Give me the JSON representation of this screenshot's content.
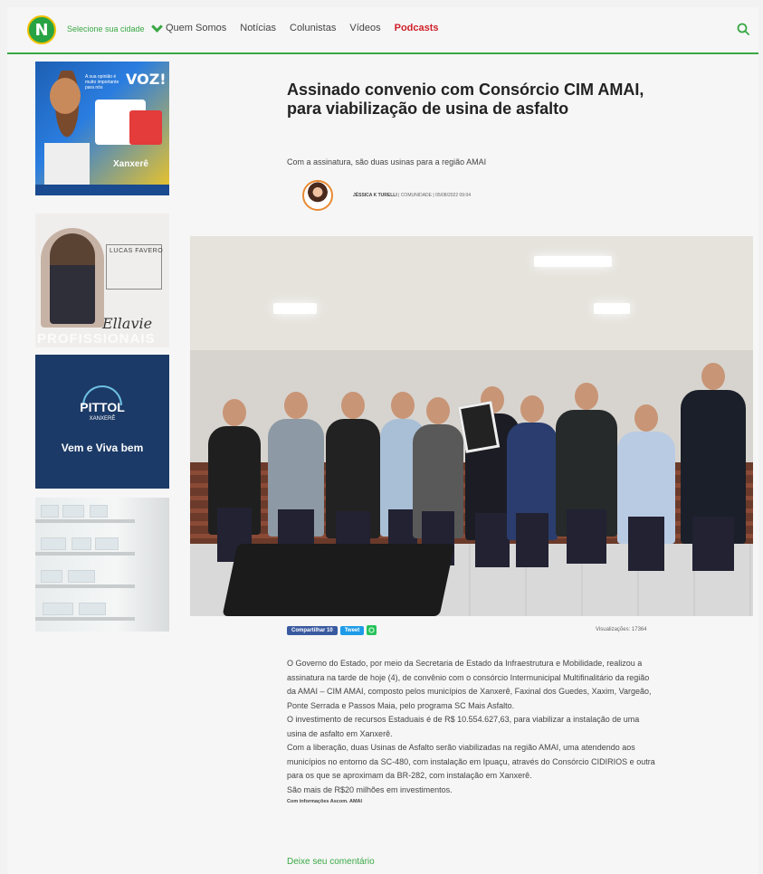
{
  "header": {
    "logo_letter": "N",
    "city_select_label": "Selecione sua cidade",
    "nav": [
      "Quem Somos",
      "Notícias",
      "Colunistas",
      "Vídeos",
      "Podcasts"
    ],
    "active_nav": "Podcasts",
    "accent_color": "#39a845",
    "active_color": "#d0202a"
  },
  "sidebar": {
    "ad1": {
      "headline": "VOZ!",
      "small": "A sua opinião é muito importante para nós",
      "city": "Xanxerê"
    },
    "ad2": {
      "name": "LUCAS FAVERO",
      "signature": "Ellavie",
      "band": "PROFISSIONAIS"
    },
    "ad3": {
      "brand": "PITTOL",
      "sub": "XANXERÊ",
      "tagline": "Vem e Viva bem"
    },
    "ad4": {
      "icon": "pharmacy-shelves"
    }
  },
  "article": {
    "title": "Assinado convenio com Consórcio CIM AMAI, para viabilização de usina de asfalto",
    "subtitle": "Com a assinatura, são duas usinas para a região AMAI",
    "author": "JÉSSICA K TURELLI",
    "category": "COMUNIDADE",
    "date": "05/08/2022 09:04",
    "share_facebook": "Compartilhar 10",
    "share_twitter": "Tweet",
    "views": "Visualizações: 17364",
    "paragraphs": [
      "O Governo do Estado, por meio da Secretaria de Estado da Infraestrutura e Mobilidade, realizou a assinatura na tarde de hoje (4), de convênio com o consórcio Intermunicipal Multifinalitário da região da AMAI – CIM AMAI, composto pelos municípios de Xanxerê, Faxinal dos Guedes, Xaxim, Vargeão, Ponte Serrada e Passos Maia, pelo programa SC Mais Asfalto.",
      "O investimento de recursos Estaduais é de R$ 10.554.627,63, para viabilizar a instalação de uma usina de asfalto em Xanxerê.",
      "Com a liberação, duas Usinas de Asfalto serão viabilizadas na região AMAI, uma atendendo aos municípios no entorno da SC-480, com instalação em Ipuaçu, através do Consórcio CIDIRIOS e outra para os que se aproximam da BR-282, com instalação em Xanxerê.",
      "São mais de R$20 milhões em investimentos."
    ],
    "source": "Com informações Ascom. AMAI",
    "comment_link": "Deixe seu comentário"
  }
}
